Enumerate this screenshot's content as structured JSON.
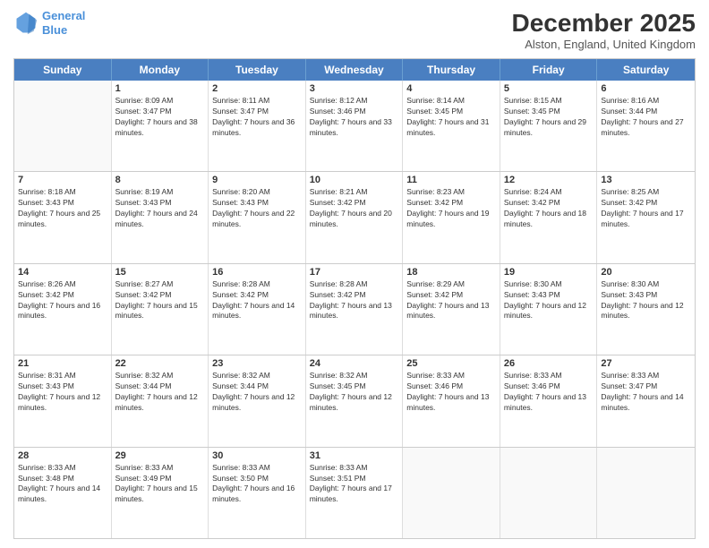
{
  "header": {
    "logo_line1": "General",
    "logo_line2": "Blue",
    "month_title": "December 2025",
    "location": "Alston, England, United Kingdom"
  },
  "day_headers": [
    "Sunday",
    "Monday",
    "Tuesday",
    "Wednesday",
    "Thursday",
    "Friday",
    "Saturday"
  ],
  "weeks": [
    [
      {
        "num": "",
        "empty": true
      },
      {
        "num": "1",
        "sunrise": "Sunrise: 8:09 AM",
        "sunset": "Sunset: 3:47 PM",
        "daylight": "Daylight: 7 hours and 38 minutes."
      },
      {
        "num": "2",
        "sunrise": "Sunrise: 8:11 AM",
        "sunset": "Sunset: 3:47 PM",
        "daylight": "Daylight: 7 hours and 36 minutes."
      },
      {
        "num": "3",
        "sunrise": "Sunrise: 8:12 AM",
        "sunset": "Sunset: 3:46 PM",
        "daylight": "Daylight: 7 hours and 33 minutes."
      },
      {
        "num": "4",
        "sunrise": "Sunrise: 8:14 AM",
        "sunset": "Sunset: 3:45 PM",
        "daylight": "Daylight: 7 hours and 31 minutes."
      },
      {
        "num": "5",
        "sunrise": "Sunrise: 8:15 AM",
        "sunset": "Sunset: 3:45 PM",
        "daylight": "Daylight: 7 hours and 29 minutes."
      },
      {
        "num": "6",
        "sunrise": "Sunrise: 8:16 AM",
        "sunset": "Sunset: 3:44 PM",
        "daylight": "Daylight: 7 hours and 27 minutes."
      }
    ],
    [
      {
        "num": "7",
        "sunrise": "Sunrise: 8:18 AM",
        "sunset": "Sunset: 3:43 PM",
        "daylight": "Daylight: 7 hours and 25 minutes."
      },
      {
        "num": "8",
        "sunrise": "Sunrise: 8:19 AM",
        "sunset": "Sunset: 3:43 PM",
        "daylight": "Daylight: 7 hours and 24 minutes."
      },
      {
        "num": "9",
        "sunrise": "Sunrise: 8:20 AM",
        "sunset": "Sunset: 3:43 PM",
        "daylight": "Daylight: 7 hours and 22 minutes."
      },
      {
        "num": "10",
        "sunrise": "Sunrise: 8:21 AM",
        "sunset": "Sunset: 3:42 PM",
        "daylight": "Daylight: 7 hours and 20 minutes."
      },
      {
        "num": "11",
        "sunrise": "Sunrise: 8:23 AM",
        "sunset": "Sunset: 3:42 PM",
        "daylight": "Daylight: 7 hours and 19 minutes."
      },
      {
        "num": "12",
        "sunrise": "Sunrise: 8:24 AM",
        "sunset": "Sunset: 3:42 PM",
        "daylight": "Daylight: 7 hours and 18 minutes."
      },
      {
        "num": "13",
        "sunrise": "Sunrise: 8:25 AM",
        "sunset": "Sunset: 3:42 PM",
        "daylight": "Daylight: 7 hours and 17 minutes."
      }
    ],
    [
      {
        "num": "14",
        "sunrise": "Sunrise: 8:26 AM",
        "sunset": "Sunset: 3:42 PM",
        "daylight": "Daylight: 7 hours and 16 minutes."
      },
      {
        "num": "15",
        "sunrise": "Sunrise: 8:27 AM",
        "sunset": "Sunset: 3:42 PM",
        "daylight": "Daylight: 7 hours and 15 minutes."
      },
      {
        "num": "16",
        "sunrise": "Sunrise: 8:28 AM",
        "sunset": "Sunset: 3:42 PM",
        "daylight": "Daylight: 7 hours and 14 minutes."
      },
      {
        "num": "17",
        "sunrise": "Sunrise: 8:28 AM",
        "sunset": "Sunset: 3:42 PM",
        "daylight": "Daylight: 7 hours and 13 minutes."
      },
      {
        "num": "18",
        "sunrise": "Sunrise: 8:29 AM",
        "sunset": "Sunset: 3:42 PM",
        "daylight": "Daylight: 7 hours and 13 minutes."
      },
      {
        "num": "19",
        "sunrise": "Sunrise: 8:30 AM",
        "sunset": "Sunset: 3:43 PM",
        "daylight": "Daylight: 7 hours and 12 minutes."
      },
      {
        "num": "20",
        "sunrise": "Sunrise: 8:30 AM",
        "sunset": "Sunset: 3:43 PM",
        "daylight": "Daylight: 7 hours and 12 minutes."
      }
    ],
    [
      {
        "num": "21",
        "sunrise": "Sunrise: 8:31 AM",
        "sunset": "Sunset: 3:43 PM",
        "daylight": "Daylight: 7 hours and 12 minutes."
      },
      {
        "num": "22",
        "sunrise": "Sunrise: 8:32 AM",
        "sunset": "Sunset: 3:44 PM",
        "daylight": "Daylight: 7 hours and 12 minutes."
      },
      {
        "num": "23",
        "sunrise": "Sunrise: 8:32 AM",
        "sunset": "Sunset: 3:44 PM",
        "daylight": "Daylight: 7 hours and 12 minutes."
      },
      {
        "num": "24",
        "sunrise": "Sunrise: 8:32 AM",
        "sunset": "Sunset: 3:45 PM",
        "daylight": "Daylight: 7 hours and 12 minutes."
      },
      {
        "num": "25",
        "sunrise": "Sunrise: 8:33 AM",
        "sunset": "Sunset: 3:46 PM",
        "daylight": "Daylight: 7 hours and 13 minutes."
      },
      {
        "num": "26",
        "sunrise": "Sunrise: 8:33 AM",
        "sunset": "Sunset: 3:46 PM",
        "daylight": "Daylight: 7 hours and 13 minutes."
      },
      {
        "num": "27",
        "sunrise": "Sunrise: 8:33 AM",
        "sunset": "Sunset: 3:47 PM",
        "daylight": "Daylight: 7 hours and 14 minutes."
      }
    ],
    [
      {
        "num": "28",
        "sunrise": "Sunrise: 8:33 AM",
        "sunset": "Sunset: 3:48 PM",
        "daylight": "Daylight: 7 hours and 14 minutes."
      },
      {
        "num": "29",
        "sunrise": "Sunrise: 8:33 AM",
        "sunset": "Sunset: 3:49 PM",
        "daylight": "Daylight: 7 hours and 15 minutes."
      },
      {
        "num": "30",
        "sunrise": "Sunrise: 8:33 AM",
        "sunset": "Sunset: 3:50 PM",
        "daylight": "Daylight: 7 hours and 16 minutes."
      },
      {
        "num": "31",
        "sunrise": "Sunrise: 8:33 AM",
        "sunset": "Sunset: 3:51 PM",
        "daylight": "Daylight: 7 hours and 17 minutes."
      },
      {
        "num": "",
        "empty": true
      },
      {
        "num": "",
        "empty": true
      },
      {
        "num": "",
        "empty": true
      }
    ]
  ]
}
